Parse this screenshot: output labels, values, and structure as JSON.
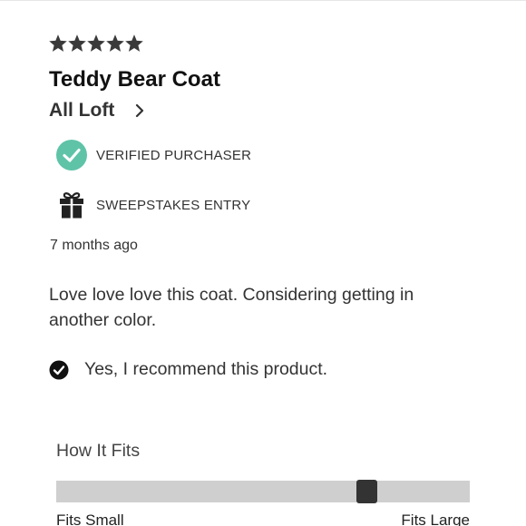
{
  "review": {
    "rating": 5,
    "rating_max": 5,
    "rating_text": "★★★★★",
    "title": "Teddy Bear Coat",
    "author": "All Loft",
    "badges": [
      {
        "label": "VERIFIED PURCHASER",
        "icon": "check-circle-icon",
        "color": "#5fc3a8"
      },
      {
        "label": "SWEEPSTAKES ENTRY",
        "icon": "gift-icon",
        "color": "#222222"
      }
    ],
    "timestamp": "7 months ago",
    "body": "Love love love this coat. Considering getting in another color.",
    "recommendation": {
      "icon": "check-circle-icon",
      "text": "Yes, I recommend this product."
    }
  },
  "fit": {
    "heading": "How It Fits",
    "min_label": "Fits Small",
    "max_label": "Fits Large",
    "value_fraction": 0.75
  },
  "colors": {
    "star": "#3a3a3a",
    "verified": "#5fc3a8",
    "track": "#cfcfcf",
    "thumb": "#333333"
  }
}
